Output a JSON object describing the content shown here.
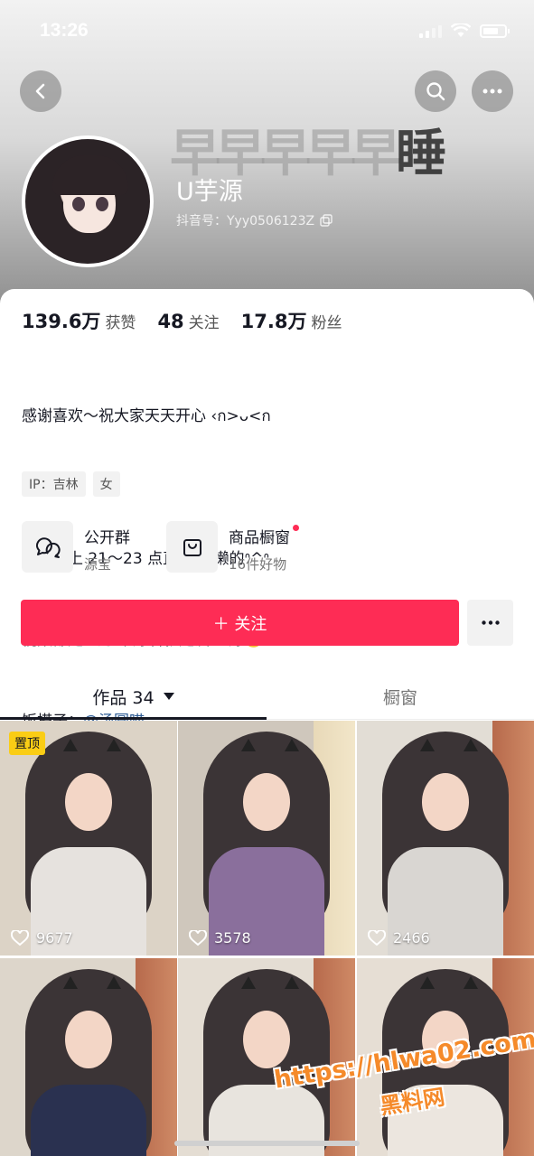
{
  "status_bar": {
    "time": "13:26"
  },
  "banner": {
    "text_light": "早早早早早",
    "text_dark": "睡"
  },
  "profile": {
    "name": "U芋源",
    "douyin_id": "抖音号：Yyy0506123Z"
  },
  "stats": [
    {
      "value": "139.6万",
      "label": "获赞"
    },
    {
      "value": "48",
      "label": "关注"
    },
    {
      "value": "17.8万",
      "label": "粉丝"
    }
  ],
  "bio": {
    "line1": "感谢喜欢～祝大家天天开心 ‹ก>ᴗ<ก",
    "line2": "每天晚上 21～23 点直播 懒懒的ᐢ^ᐢ",
    "line3": "视频都是 P的 不好看就是没 P 好🤓",
    "line4_prefix": "饭搭子：",
    "line4_mention": "@汤圆喵"
  },
  "tags": [
    "IP：吉林",
    "女"
  ],
  "shortcuts": [
    {
      "title": "公开群",
      "subtitle": "源宝",
      "icon": "group-chat-icon"
    },
    {
      "title": "商品橱窗",
      "subtitle": "16件好物",
      "icon": "shopping-bag-icon"
    }
  ],
  "follow_label": "＋ 关注",
  "tabs": {
    "works": "作品 34",
    "shop": "橱窗"
  },
  "videos": [
    {
      "likes": "9677",
      "pinned": "置顶",
      "outfit": "#e6e2de"
    },
    {
      "likes": "3578",
      "outfit": "#8a6f9c"
    },
    {
      "likes": "2466",
      "outfit": "#d9d6d2"
    },
    {
      "likes": "",
      "outfit": "#2a3150"
    },
    {
      "likes": "",
      "outfit": "#e8e4de"
    },
    {
      "likes": "",
      "outfit": "#ece6df"
    }
  ],
  "watermark": {
    "url": "https://hlwa02.com",
    "name": "黑料网"
  },
  "colors": {
    "accent": "#fe2c55",
    "mention": "#2e5c95",
    "pin": "#facd15"
  }
}
